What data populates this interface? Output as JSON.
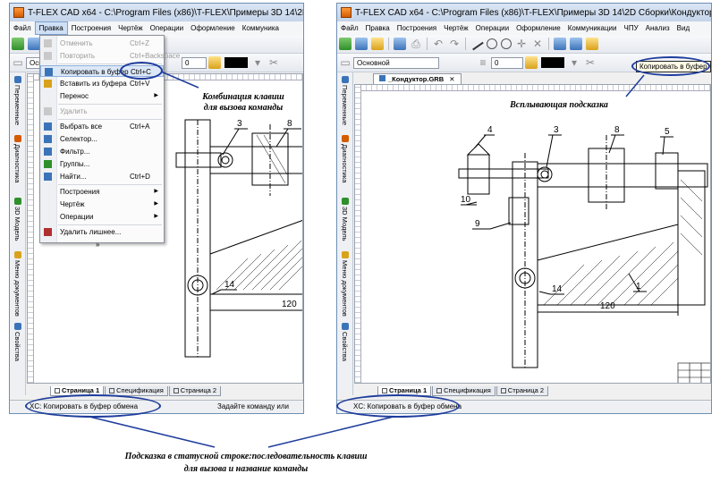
{
  "left_window": {
    "title": "T-FLEX CAD x64 - C:\\Program Files (x86)\\T-FLEX\\Примеры 3D 14\\2D Сбор",
    "menu": [
      "Файл",
      "Правка",
      "Построения",
      "Чертёж",
      "Операции",
      "Оформление",
      "Коммуника"
    ],
    "active_menu": "Правка",
    "layer_combo": "Осн",
    "width_value": "0",
    "left_tabs": [
      "Переменные",
      "Диагностика",
      "3D Модель",
      "Меню документов",
      "Свойства"
    ],
    "page_tabs": [
      "Страница 1",
      "Спецификация",
      "Страница 2"
    ],
    "status_left": "XC: Копировать в буфер обмена",
    "status_right": "Задайте команду или",
    "dropdown": [
      {
        "label": "Отменить",
        "shortcut": "Ctrl+Z",
        "disabled": true,
        "icon": "undo-icon"
      },
      {
        "label": "Повторить",
        "shortcut": "Ctrl+Backspace",
        "disabled": true,
        "icon": "redo-icon"
      },
      {
        "label": "Копировать в буфер",
        "shortcut": "Ctrl+C",
        "highlight": true,
        "icon": "copy-icon"
      },
      {
        "label": "Вставить из буфера",
        "shortcut": "Ctrl+V",
        "icon": "paste-icon"
      },
      {
        "label": "Перенос",
        "submenu": true,
        "icon": ""
      },
      {
        "label": "Удалить",
        "disabled": true,
        "icon": "delete-icon"
      },
      {
        "label": "Выбрать все",
        "shortcut": "Ctrl+A",
        "icon": "select-all-icon"
      },
      {
        "label": "Селектор...",
        "icon": "selector-icon"
      },
      {
        "label": "Фильтр...",
        "icon": "filter-icon"
      },
      {
        "label": "Группы...",
        "icon": "groups-icon"
      },
      {
        "label": "Найти...",
        "shortcut": "Ctrl+D",
        "icon": "find-icon"
      },
      {
        "label": "Построения",
        "submenu": true,
        "icon": ""
      },
      {
        "label": "Чертёж",
        "submenu": true,
        "icon": ""
      },
      {
        "label": "Операции",
        "submenu": true,
        "icon": ""
      },
      {
        "label": "Удалить лишнее...",
        "icon": "clean-icon"
      },
      {
        "label": "»",
        "icon": ""
      }
    ],
    "drawing_labels": {
      "l3": "3",
      "l8": "8",
      "l14": "14",
      "dim": "120"
    }
  },
  "right_window": {
    "title": "T-FLEX CAD x64 - C:\\Program Files (x86)\\T-FLEX\\Примеры 3D 14\\2D Сборки\\Кондуктор 2D\\_Конд",
    "menu": [
      "Файл",
      "Правка",
      "Построения",
      "Чертёж",
      "Операции",
      "Оформление",
      "Коммуникации",
      "ЧПУ",
      "Анализ",
      "Вид"
    ],
    "layer_combo": "Основной",
    "width_value": "0",
    "doc_tab": "_Кондуктор.GRB",
    "tooltip": "Копировать в буфер",
    "left_tabs": [
      "Переменные",
      "Диагностика",
      "3D Модель",
      "Меню документов",
      "Свойства"
    ],
    "page_tabs": [
      "Страница 1",
      "Спецификация",
      "Страница 2"
    ],
    "status_left": "XC: Копировать в буфер обмена",
    "drawing_labels": {
      "l4": "4",
      "l3": "3",
      "l8": "8",
      "l5": "5",
      "l10": "10",
      "l9": "9",
      "l14": "14",
      "l1": "1",
      "dim": "120"
    }
  },
  "annotations": {
    "left": [
      "Комбинация клавиш",
      "для вызова команды"
    ],
    "right": "Всплывающая подсказка",
    "bottom": [
      "Подсказка в статусной строке:последовательность клавиш",
      "для вызова и название команды"
    ]
  },
  "colors": {
    "annotation_outline": "#1f3d9c",
    "title_bar": "#c4d4ea",
    "highlight": "#dce8f8"
  }
}
